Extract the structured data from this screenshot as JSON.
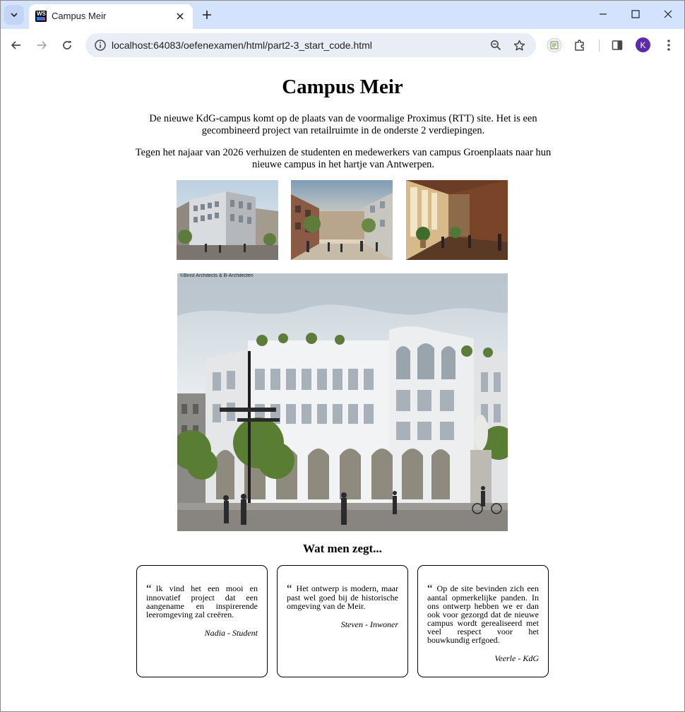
{
  "browser": {
    "tab_title": "Campus Meir",
    "url": "localhost:64083/oefenexamen/html/part2-3_start_code.html",
    "profile_initial": "K",
    "favicon_text": "WS"
  },
  "page": {
    "title": "Campus Meir",
    "intro_1": "De nieuwe KdG-campus komt op de plaats van de voormalige Proximus (RTT) site. Het is een gecombineerd project van retailruimte in de onderste 2 verdiepingen.",
    "intro_2": "Tegen het najaar van 2026 verhuizen de studenten en medewerkers van campus Groenplaats naar hun nieuwe campus in het hartje van Antwerpen.",
    "hero_credit": "©Binst Architects & B-Architecten",
    "section_title": "Wat men zegt...",
    "testimonials": [
      {
        "quote": "Ik vind het een mooi en innovatief project dat een aangename en inspirerende leeromgeving zal creëren.",
        "author": "Nadia - Student"
      },
      {
        "quote": "Het ontwerp is modern, maar past wel goed bij de historische omgeving van de Meir.",
        "author": "Steven - Inwoner"
      },
      {
        "quote": "Op de site bevinden zich een aantal opmerkelijke panden. In ons ontwerp hebben we er dan ook voor gezorgd dat de nieuwe campus wordt gerealiseerd met veel respect voor het bouwkundig erfgoed.",
        "author": "Veerle - KdG"
      }
    ],
    "quote_mark": "“"
  },
  "colors": {
    "chrome_bg": "#d3e3fd",
    "omnibox_bg": "#e9eef6",
    "avatar": "#5b2bab"
  }
}
